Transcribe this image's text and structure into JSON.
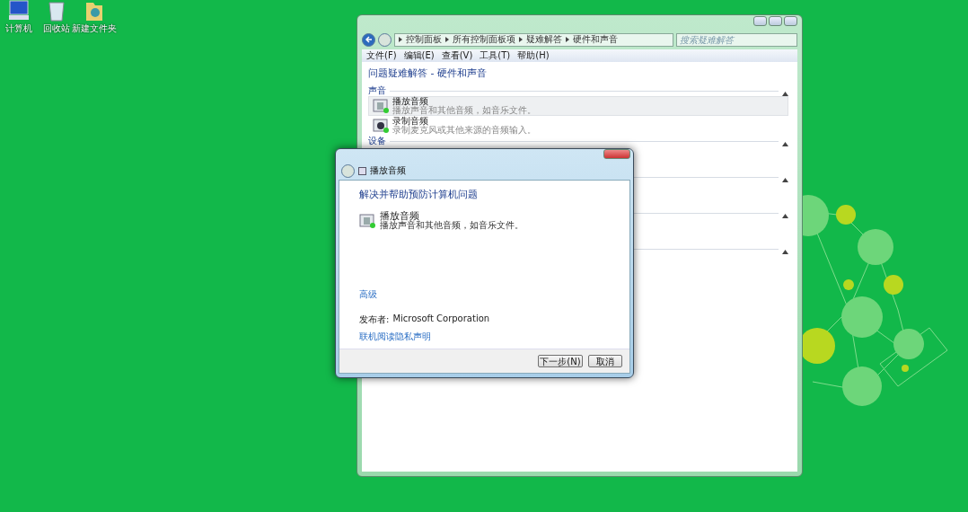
{
  "desktop_icons": [
    {
      "kind": "computer",
      "label": "计算机"
    },
    {
      "kind": "recycle",
      "label": "回收站"
    },
    {
      "kind": "folder",
      "label": "新建文件夹"
    }
  ],
  "explorer": {
    "breadcrumbs": [
      "控制面板",
      "所有控制面板项",
      "疑难解答",
      "硬件和声音"
    ],
    "search": {
      "placeholder": "搜索疑难解答"
    },
    "menu": [
      "文件(F)",
      "编辑(E)",
      "查看(V)",
      "工具(T)",
      "帮助(H)"
    ],
    "heading": "问题疑难解答 - 硬件和声音",
    "sections": [
      {
        "title": "声音",
        "expanded": true,
        "items": [
          {
            "kind": "speaker",
            "name": "播放音频",
            "description": "播放声音和其他音频，如音乐文件。",
            "selected": true
          },
          {
            "kind": "mic",
            "name": "录制音频",
            "description": "录制麦克风或其他来源的音频输入。",
            "selected": false
          }
        ]
      },
      {
        "title": "设备",
        "expanded": true
      },
      {
        "expanded": true
      },
      {
        "expanded": true
      },
      {
        "expanded": true
      }
    ]
  },
  "dialog": {
    "title": "播放音频",
    "heading": "解决并帮助预防计算机问题",
    "item": {
      "name": "播放音频",
      "description": "播放声音和其他音频，如音乐文件。"
    },
    "advanced_link": "高级",
    "publisher_label": "发布者:",
    "publisher": "Microsoft Corporation",
    "privacy_link": "联机阅读隐私声明",
    "buttons": [
      {
        "label": "下一步(N)",
        "kind": "next"
      },
      {
        "label": "取消",
        "kind": "cancel"
      }
    ]
  }
}
